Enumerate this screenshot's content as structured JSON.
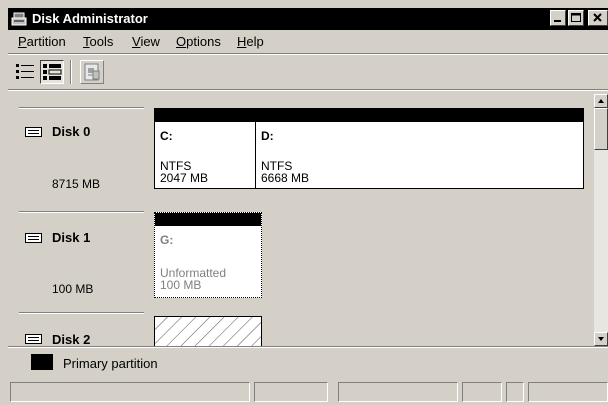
{
  "window": {
    "title": "Disk Administrator"
  },
  "menu": {
    "items": [
      {
        "label": "Partition",
        "mnemonic": "P",
        "rest": "artition"
      },
      {
        "label": "Tools",
        "mnemonic": "T",
        "rest": "ools"
      },
      {
        "label": "View",
        "mnemonic": "V",
        "rest": "iew"
      },
      {
        "label": "Options",
        "mnemonic": "O",
        "rest": "ptions"
      },
      {
        "label": "Help",
        "mnemonic": "H",
        "rest": "elp"
      }
    ]
  },
  "toolbar": {
    "buttons": [
      "volumes-view-icon",
      "disk-configuration-view-icon",
      "properties-icon"
    ]
  },
  "disks": [
    {
      "name": "Disk 0",
      "size": "8715 MB",
      "volumes": [
        {
          "letter": "C:",
          "filesystem": "NTFS",
          "size": "2047 MB"
        },
        {
          "letter": "D:",
          "filesystem": "NTFS",
          "size": "6668 MB"
        }
      ]
    },
    {
      "name": "Disk 1",
      "size": "100 MB",
      "volumes": [
        {
          "letter": "G:",
          "filesystem": "Unformatted",
          "size": "100 MB"
        }
      ]
    },
    {
      "name": "Disk 2",
      "size": "",
      "volumes": []
    }
  ],
  "legend": {
    "label": "Primary partition",
    "color": "#000000"
  },
  "status": {
    "cells": [
      "",
      "",
      "",
      "",
      "",
      ""
    ]
  },
  "colors": {
    "titlebar": "#000000",
    "face": "#d4d0c8",
    "volume_bg": "#ffffff"
  }
}
